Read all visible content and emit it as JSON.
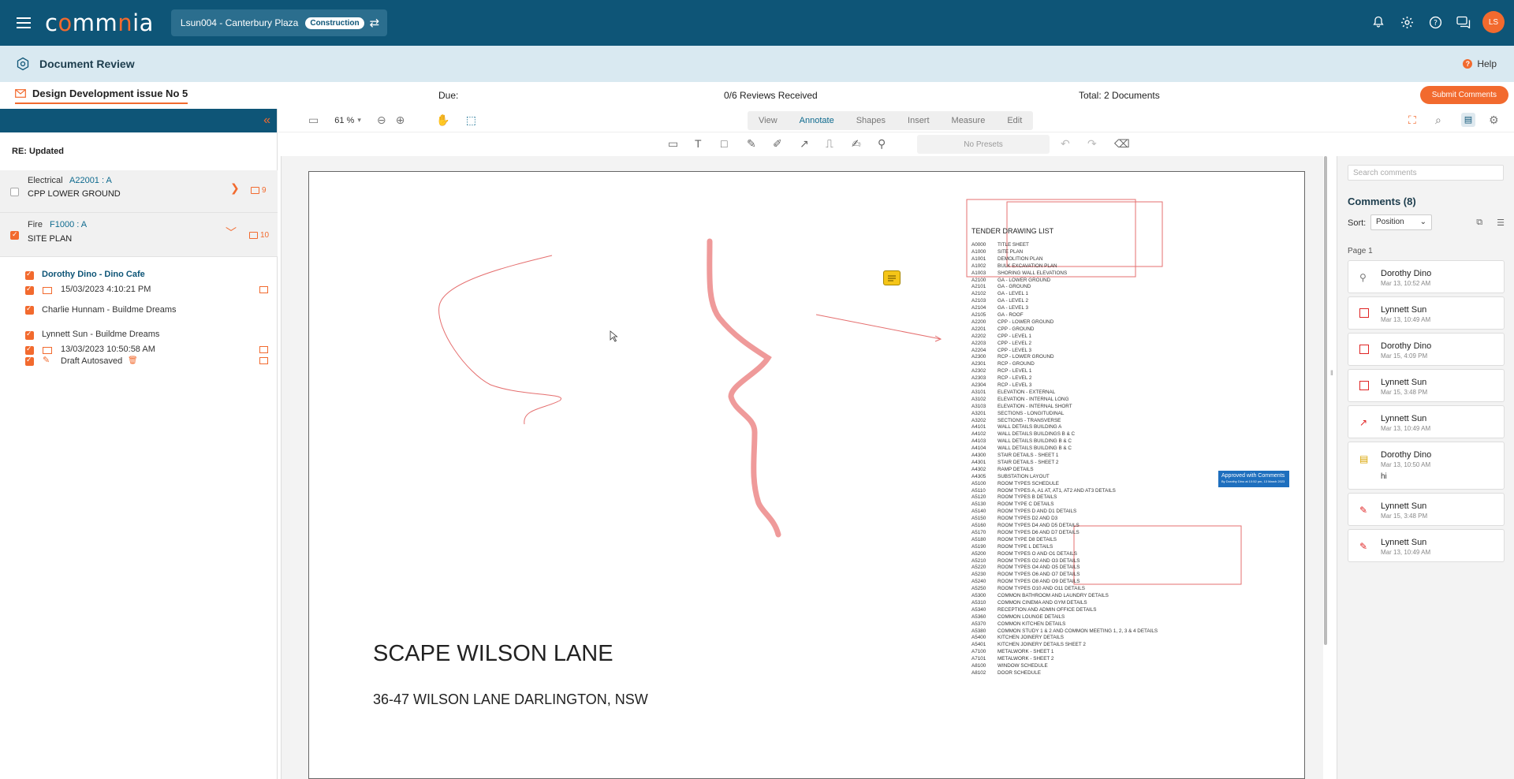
{
  "app": {
    "logo_text": "commnia",
    "project_name": "Lsun004 - Canterbury Plaza",
    "project_tag": "Construction",
    "avatar": "LS",
    "icons": [
      "bell-icon",
      "gear-icon",
      "help-icon",
      "chat-icon"
    ]
  },
  "page": {
    "title": "Document Review",
    "help": "Help"
  },
  "review": {
    "package_title": "Design Development issue No 5",
    "due_label": "Due:",
    "reviews_received": "0/6 Reviews Received",
    "total": "Total: 2 Documents",
    "submit_button": "Submit Comments"
  },
  "left_panel": {
    "section_title": "RE: Updated",
    "documents": [
      {
        "category": "Electrical",
        "code": "A22001 : A",
        "name": "CPP LOWER GROUND",
        "comments": "9",
        "checked": false
      },
      {
        "category": "Fire",
        "code": "F1000 : A",
        "name": "SITE PLAN",
        "comments": "10",
        "checked": true
      }
    ],
    "reviewers": [
      {
        "name": "Dorothy Dino - Dino Cafe",
        "datetime": "15/03/2023 4:10:21 PM"
      },
      {
        "name": "Charlie Hunnam - Buildme Dreams"
      },
      {
        "name": "Lynnett Sun - Buildme Dreams",
        "datetime": "13/03/2023 10:50:58 AM",
        "draft": "Draft Autosaved"
      }
    ]
  },
  "toolbar": {
    "zoom": "61 %",
    "tabs": [
      "View",
      "Annotate",
      "Shapes",
      "Insert",
      "Measure",
      "Edit"
    ],
    "active_tab": "Annotate",
    "presets": "No Presets"
  },
  "drawing": {
    "title": "SCAPE WILSON LANE",
    "address": "36-47 WILSON LANE DARLINGTON, NSW",
    "list_title": "TENDER DRAWING LIST",
    "stamp_title": "Approved with Comments",
    "stamp_sub": "By Dorothy Dino at 10:52 pm, 13 March 2023",
    "drawing_list": [
      [
        "A0000",
        "TITLE SHEET"
      ],
      [
        "A1000",
        "SITE PLAN"
      ],
      [
        "A1001",
        "DEMOLITION PLAN"
      ],
      [
        "A1002",
        "BULK EXCAVATION PLAN"
      ],
      [
        "A1003",
        "SHORING WALL ELEVATIONS"
      ],
      [
        "A2100",
        "GA - LOWER GROUND"
      ],
      [
        "A2101",
        "GA - GROUND"
      ],
      [
        "A2102",
        "GA - LEVEL 1"
      ],
      [
        "A2103",
        "GA - LEVEL 2"
      ],
      [
        "A2104",
        "GA - LEVEL 3"
      ],
      [
        "A2105",
        "GA - ROOF"
      ],
      [
        "A2200",
        "CPP - LOWER GROUND"
      ],
      [
        "A2201",
        "CPP - GROUND"
      ],
      [
        "A2202",
        "CPP - LEVEL 1"
      ],
      [
        "A2203",
        "CPP - LEVEL 2"
      ],
      [
        "A2204",
        "CPP - LEVEL 3"
      ],
      [
        "A2300",
        "RCP - LOWER GROUND"
      ],
      [
        "A2301",
        "RCP - GROUND"
      ],
      [
        "A2302",
        "RCP - LEVEL 1"
      ],
      [
        "A2303",
        "RCP - LEVEL 2"
      ],
      [
        "A2304",
        "RCP - LEVEL 3"
      ],
      [
        "A3101",
        "ELEVATION - EXTERNAL"
      ],
      [
        "A3102",
        "ELEVATION - INTERNAL LONG"
      ],
      [
        "A3103",
        "ELEVATION - INTERNAL SHORT"
      ],
      [
        "A3201",
        "SECTIONS - LONGITUDINAL"
      ],
      [
        "A3202",
        "SECTIONS - TRANSVERSE"
      ],
      [
        "A4101",
        "WALL DETAILS BUILDING A"
      ],
      [
        "A4102",
        "WALL DETAILS BUILDINGS B & C"
      ],
      [
        "A4103",
        "WALL DETAILS BUILDING B & C"
      ],
      [
        "A4104",
        "WALL DETAILS BUILDING B & C"
      ],
      [
        "A4300",
        "STAIR DETAILS - SHEET 1"
      ],
      [
        "A4301",
        "STAIR DETAILS - SHEET 2"
      ],
      [
        "A4302",
        "RAMP DETAILS"
      ],
      [
        "A4305",
        "SUBSTATION LAYOUT"
      ],
      [
        "A5100",
        "ROOM TYPES SCHEDULE"
      ],
      [
        "A5110",
        "ROOM TYPES A, A1 AT, AT1, AT2 AND AT3 DETAILS"
      ],
      [
        "A5120",
        "ROOM TYPES B DETAILS"
      ],
      [
        "A5130",
        "ROOM TYPE C DETAILS"
      ],
      [
        "A5140",
        "ROOM TYPES D AND D1 DETAILS"
      ],
      [
        "A5150",
        "ROOM TYPES D2 AND D3"
      ],
      [
        "A5160",
        "ROOM TYPES D4 AND D5 DETAILS"
      ],
      [
        "A5170",
        "ROOM TYPES D6 AND D7 DETAILS"
      ],
      [
        "A5180",
        "ROOM TYPE D8 DETAILS"
      ],
      [
        "A5190",
        "ROOM TYPE L DETAILS"
      ],
      [
        "A5200",
        "ROOM TYPES O AND O1 DETAILS"
      ],
      [
        "A5210",
        "ROOM TYPES O2 AND O3 DETAILS"
      ],
      [
        "A5220",
        "ROOM TYPES O4 AND O5 DETAILS"
      ],
      [
        "A5230",
        "ROOM TYPES O6 AND O7 DETAILS"
      ],
      [
        "A5240",
        "ROOM TYPES O8 AND O9 DETAILS"
      ],
      [
        "A5250",
        "ROOM TYPES O10 AND O11 DETAILS"
      ],
      [
        "A5300",
        "COMMON BATHROOM AND LAUNDRY DETAILS"
      ],
      [
        "A5310",
        "COMMON CINEMA AND GYM DETAILS"
      ],
      [
        "A5340",
        "RECEPTION AND ADMIN OFFICE DETAILS"
      ],
      [
        "A5360",
        "COMMON LOUNGE DETAILS"
      ],
      [
        "A5370",
        "COMMON KITCHEN DETAILS"
      ],
      [
        "A5380",
        "COMMON STUDY 1 & 2 AND COMMON MEETING 1, 2, 3 & 4 DETAILS"
      ],
      [
        "A5400",
        "KITCHEN JOINERY DETAILS"
      ],
      [
        "A5401",
        "KITCHEN JOINERY DETAILS SHEET 2"
      ],
      [
        "A7100",
        "METALWORK - SHEET 1"
      ],
      [
        "A7101",
        "METALWORK - SHEET 2"
      ],
      [
        "A8100",
        "WINDOW SCHEDULE"
      ],
      [
        "A8102",
        "DOOR SCHEDULE"
      ]
    ]
  },
  "comments_panel": {
    "search_placeholder": "Search comments",
    "title": "Comments (8)",
    "sort_label": "Sort:",
    "sort_value": "Position",
    "page_label": "Page 1",
    "items": [
      {
        "author": "Dorothy Dino",
        "date": "Mar 13, 10:52 AM",
        "icon": "stamp-icon"
      },
      {
        "author": "Lynnett Sun",
        "date": "Mar 13, 10:49 AM",
        "icon": "rectangle-icon"
      },
      {
        "author": "Dorothy Dino",
        "date": "Mar 15, 4:09 PM",
        "icon": "rectangle-icon"
      },
      {
        "author": "Lynnett Sun",
        "date": "Mar 15, 3:48 PM",
        "icon": "rectangle-icon"
      },
      {
        "author": "Lynnett Sun",
        "date": "Mar 13, 10:49 AM",
        "icon": "arrow-icon"
      },
      {
        "author": "Dorothy Dino",
        "date": "Mar 13, 10:50 AM",
        "icon": "note-icon",
        "text": "hi"
      },
      {
        "author": "Lynnett Sun",
        "date": "Mar 15, 3:48 PM",
        "icon": "freehand-icon"
      },
      {
        "author": "Lynnett Sun",
        "date": "Mar 13, 10:49 AM",
        "icon": "freehand-icon"
      }
    ]
  },
  "colors": {
    "brand": "#0e5577",
    "accent": "#f26a2e",
    "annotation": "#e56f6f"
  }
}
